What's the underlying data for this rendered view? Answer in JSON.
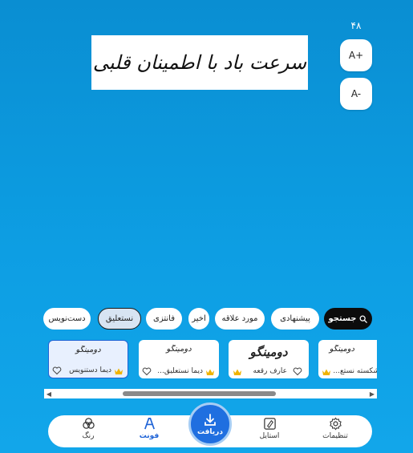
{
  "font_size": {
    "value": "۴۸",
    "increase_label": "A+",
    "decrease_label": "A-"
  },
  "preview": {
    "text": "سرعت باد با اطمینان قلبی"
  },
  "filters": {
    "search_label": "جستجو",
    "chips": [
      "پیشنهادی",
      "مورد علاقه",
      "اخیر",
      "فانتزی",
      "نستعلیق",
      "دست‌نویس"
    ],
    "active_chip": "نستعلیق"
  },
  "fonts": [
    {
      "preview": "دومینگو",
      "name": "دیما دستنویس"
    },
    {
      "preview": "دومینگو",
      "name": "دیما نستعلیق..."
    },
    {
      "preview": "دومینگو",
      "name": "عارف رقعه"
    },
    {
      "preview": "دومینگو",
      "name": "شکسته نستع..."
    }
  ],
  "bottom_nav": {
    "settings": "تنظیمات",
    "style": "استایل",
    "download": "دریافت",
    "font": "فونت",
    "color": "رنگ"
  },
  "colors": {
    "background": "#0d9ee3",
    "accent": "#1f63d6",
    "crown": "#f0b400"
  }
}
